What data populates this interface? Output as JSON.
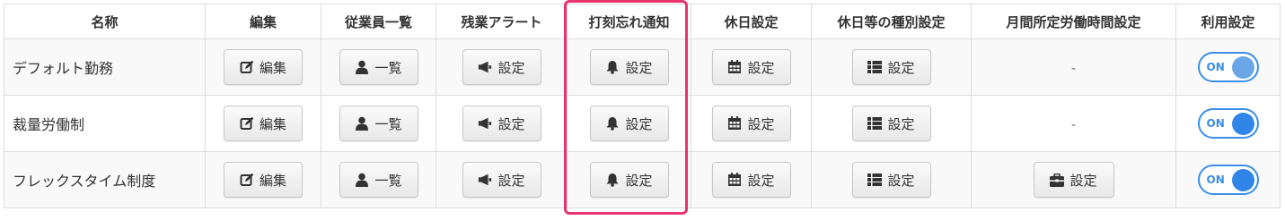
{
  "headers": [
    "名称",
    "編集",
    "従業員一覧",
    "残業アラート",
    "打刻忘れ通知",
    "休日設定",
    "休日等の種別設定",
    "月間所定労働時間設定",
    "利用設定"
  ],
  "rows": [
    {
      "name": "デフォルト勤務",
      "edit": "編集",
      "employees": "一覧",
      "overtime": "設定",
      "punch": "設定",
      "holiday": "設定",
      "holiday_type": "設定",
      "monthly_hours": "-",
      "usage": "ON"
    },
    {
      "name": "裁量労働制",
      "edit": "編集",
      "employees": "一覧",
      "overtime": "設定",
      "punch": "設定",
      "holiday": "設定",
      "holiday_type": "設定",
      "monthly_hours": "-",
      "usage": "ON"
    },
    {
      "name": "フレックスタイム制度",
      "edit": "編集",
      "employees": "一覧",
      "overtime": "設定",
      "punch": "設定",
      "holiday": "設定",
      "holiday_type": "設定",
      "monthly_hours": "設定",
      "usage": "ON"
    }
  ],
  "icons": {
    "edit": "edit-icon",
    "employees": "user-icon",
    "overtime": "megaphone-icon",
    "punch": "bell-icon",
    "holiday": "calendar-icon",
    "holiday_type": "list-icon",
    "monthly_hours": "briefcase-icon"
  },
  "colors": {
    "highlight": "#e8336d",
    "toggle": "#2f86e8"
  }
}
